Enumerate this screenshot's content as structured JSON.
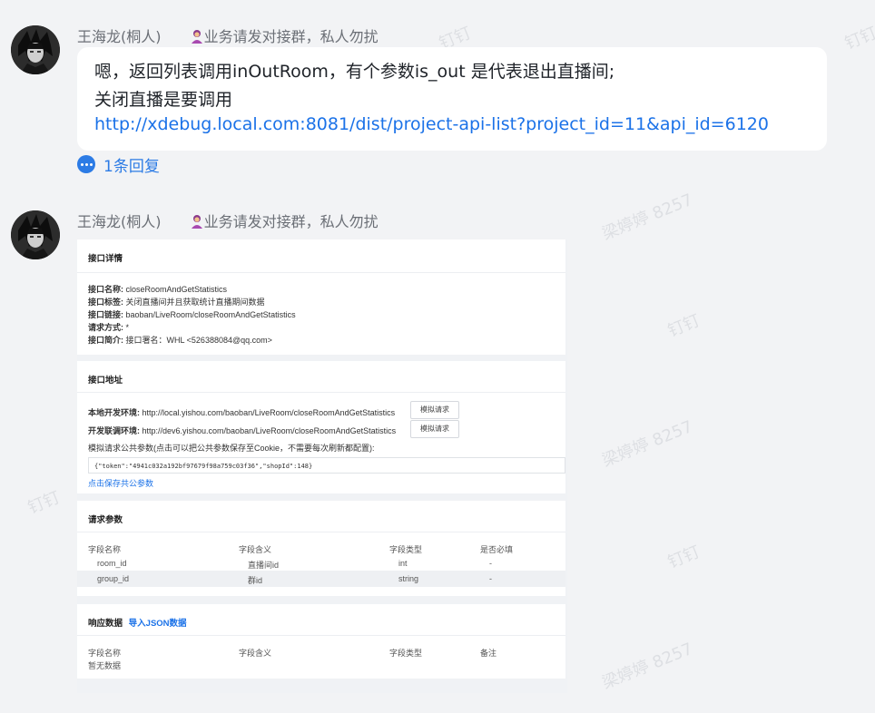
{
  "messages": [
    {
      "sender": "王海龙(桐人)",
      "tag": "业务请发对接群，私人勿扰",
      "lines": [
        "嗯，返回列表调用inOutRoom，有个参数is_out 是代表退出直播间;",
        "关闭直播是要调用"
      ],
      "link": "http://xdebug.local.com:8081/dist/project-api-list?project_id=11&api_id=6120",
      "reply_label": "1条回复"
    },
    {
      "sender": "王海龙(桐人)",
      "tag": "业务请发对接群，私人勿扰"
    }
  ],
  "screenshot": {
    "details": {
      "title": "接口详情",
      "rows": [
        {
          "k": "接口名称:",
          "v": " closeRoomAndGetStatistics"
        },
        {
          "k": "接口标签:",
          "v": " 关闭直播间并且获取统计直播期间数据"
        },
        {
          "k": "接口链接:",
          "v": " baoban/LiveRoom/closeRoomAndGetStatistics"
        },
        {
          "k": "请求方式:",
          "v": " *"
        },
        {
          "k": "接口简介:",
          "v": " 接口署名：WHL <526388084@qq.com>"
        }
      ]
    },
    "address": {
      "title": "接口地址",
      "local_label": "本地开发环境:",
      "local_url": " http://local.yishou.com/baoban/LiveRoom/closeRoomAndGetStatistics",
      "dev_label": "开发联调环境:",
      "dev_url": " http://dev6.yishou.com/baoban/LiveRoom/closeRoomAndGetStatistics",
      "mock_button": "模拟请求",
      "params_hint": "模拟请求公共参数(点击可以把公共参数保存至Cookie，不需要每次刷新都配置):",
      "params_value": "{\"token\":\"4941c032a192bf97679f98a759c03f36\",\"shopId\":148}",
      "save_link": "点击保存共公参数"
    },
    "request": {
      "title": "请求参数",
      "headers": [
        "字段名称",
        "字段含义",
        "字段类型",
        "是否必填"
      ],
      "rows": [
        [
          "room_id",
          "直播间id",
          "int",
          "-"
        ],
        [
          "group_id",
          "群id",
          "string",
          "-"
        ]
      ]
    },
    "response": {
      "title": "响应数据",
      "import_link": "导入JSON数据",
      "headers": [
        "字段名称",
        "字段含义",
        "字段类型",
        "备注"
      ],
      "empty": "暂无数据"
    }
  },
  "watermarks": [
    "钉钉",
    "梁婷婷 8257"
  ]
}
